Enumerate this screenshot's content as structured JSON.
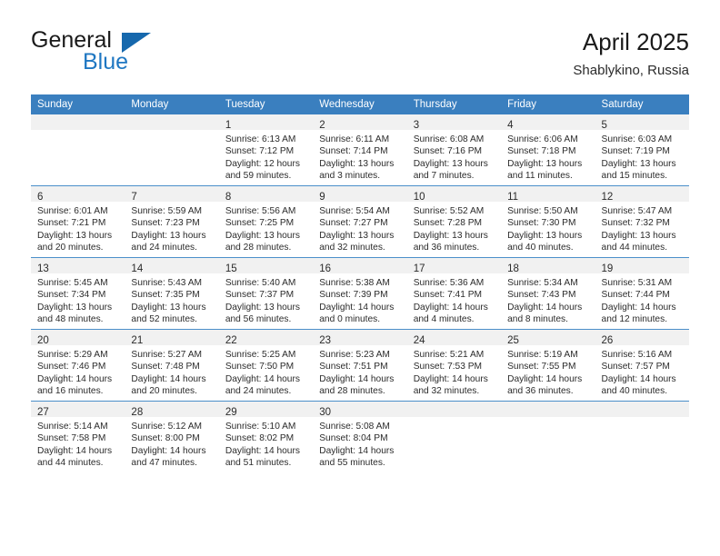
{
  "brand": {
    "name_top": "General",
    "name_bottom": "Blue",
    "accent_color": "#1f77c2",
    "triangle_color": "#1668ad"
  },
  "header": {
    "title": "April 2025",
    "subtitle": "Shablykino, Russia"
  },
  "calendar": {
    "header_bg": "#3a7fbf",
    "header_text_color": "#ffffff",
    "daynum_strip_bg": "#f1f1f1",
    "row_divider_color": "#4b8fca",
    "weekday_headers": [
      "Sunday",
      "Monday",
      "Tuesday",
      "Wednesday",
      "Thursday",
      "Friday",
      "Saturday"
    ],
    "weeks": [
      [
        {
          "day": "",
          "lines": []
        },
        {
          "day": "",
          "lines": []
        },
        {
          "day": "1",
          "lines": [
            "Sunrise: 6:13 AM",
            "Sunset: 7:12 PM",
            "Daylight: 12 hours",
            "and 59 minutes."
          ]
        },
        {
          "day": "2",
          "lines": [
            "Sunrise: 6:11 AM",
            "Sunset: 7:14 PM",
            "Daylight: 13 hours",
            "and 3 minutes."
          ]
        },
        {
          "day": "3",
          "lines": [
            "Sunrise: 6:08 AM",
            "Sunset: 7:16 PM",
            "Daylight: 13 hours",
            "and 7 minutes."
          ]
        },
        {
          "day": "4",
          "lines": [
            "Sunrise: 6:06 AM",
            "Sunset: 7:18 PM",
            "Daylight: 13 hours",
            "and 11 minutes."
          ]
        },
        {
          "day": "5",
          "lines": [
            "Sunrise: 6:03 AM",
            "Sunset: 7:19 PM",
            "Daylight: 13 hours",
            "and 15 minutes."
          ]
        }
      ],
      [
        {
          "day": "6",
          "lines": [
            "Sunrise: 6:01 AM",
            "Sunset: 7:21 PM",
            "Daylight: 13 hours",
            "and 20 minutes."
          ]
        },
        {
          "day": "7",
          "lines": [
            "Sunrise: 5:59 AM",
            "Sunset: 7:23 PM",
            "Daylight: 13 hours",
            "and 24 minutes."
          ]
        },
        {
          "day": "8",
          "lines": [
            "Sunrise: 5:56 AM",
            "Sunset: 7:25 PM",
            "Daylight: 13 hours",
            "and 28 minutes."
          ]
        },
        {
          "day": "9",
          "lines": [
            "Sunrise: 5:54 AM",
            "Sunset: 7:27 PM",
            "Daylight: 13 hours",
            "and 32 minutes."
          ]
        },
        {
          "day": "10",
          "lines": [
            "Sunrise: 5:52 AM",
            "Sunset: 7:28 PM",
            "Daylight: 13 hours",
            "and 36 minutes."
          ]
        },
        {
          "day": "11",
          "lines": [
            "Sunrise: 5:50 AM",
            "Sunset: 7:30 PM",
            "Daylight: 13 hours",
            "and 40 minutes."
          ]
        },
        {
          "day": "12",
          "lines": [
            "Sunrise: 5:47 AM",
            "Sunset: 7:32 PM",
            "Daylight: 13 hours",
            "and 44 minutes."
          ]
        }
      ],
      [
        {
          "day": "13",
          "lines": [
            "Sunrise: 5:45 AM",
            "Sunset: 7:34 PM",
            "Daylight: 13 hours",
            "and 48 minutes."
          ]
        },
        {
          "day": "14",
          "lines": [
            "Sunrise: 5:43 AM",
            "Sunset: 7:35 PM",
            "Daylight: 13 hours",
            "and 52 minutes."
          ]
        },
        {
          "day": "15",
          "lines": [
            "Sunrise: 5:40 AM",
            "Sunset: 7:37 PM",
            "Daylight: 13 hours",
            "and 56 minutes."
          ]
        },
        {
          "day": "16",
          "lines": [
            "Sunrise: 5:38 AM",
            "Sunset: 7:39 PM",
            "Daylight: 14 hours",
            "and 0 minutes."
          ]
        },
        {
          "day": "17",
          "lines": [
            "Sunrise: 5:36 AM",
            "Sunset: 7:41 PM",
            "Daylight: 14 hours",
            "and 4 minutes."
          ]
        },
        {
          "day": "18",
          "lines": [
            "Sunrise: 5:34 AM",
            "Sunset: 7:43 PM",
            "Daylight: 14 hours",
            "and 8 minutes."
          ]
        },
        {
          "day": "19",
          "lines": [
            "Sunrise: 5:31 AM",
            "Sunset: 7:44 PM",
            "Daylight: 14 hours",
            "and 12 minutes."
          ]
        }
      ],
      [
        {
          "day": "20",
          "lines": [
            "Sunrise: 5:29 AM",
            "Sunset: 7:46 PM",
            "Daylight: 14 hours",
            "and 16 minutes."
          ]
        },
        {
          "day": "21",
          "lines": [
            "Sunrise: 5:27 AM",
            "Sunset: 7:48 PM",
            "Daylight: 14 hours",
            "and 20 minutes."
          ]
        },
        {
          "day": "22",
          "lines": [
            "Sunrise: 5:25 AM",
            "Sunset: 7:50 PM",
            "Daylight: 14 hours",
            "and 24 minutes."
          ]
        },
        {
          "day": "23",
          "lines": [
            "Sunrise: 5:23 AM",
            "Sunset: 7:51 PM",
            "Daylight: 14 hours",
            "and 28 minutes."
          ]
        },
        {
          "day": "24",
          "lines": [
            "Sunrise: 5:21 AM",
            "Sunset: 7:53 PM",
            "Daylight: 14 hours",
            "and 32 minutes."
          ]
        },
        {
          "day": "25",
          "lines": [
            "Sunrise: 5:19 AM",
            "Sunset: 7:55 PM",
            "Daylight: 14 hours",
            "and 36 minutes."
          ]
        },
        {
          "day": "26",
          "lines": [
            "Sunrise: 5:16 AM",
            "Sunset: 7:57 PM",
            "Daylight: 14 hours",
            "and 40 minutes."
          ]
        }
      ],
      [
        {
          "day": "27",
          "lines": [
            "Sunrise: 5:14 AM",
            "Sunset: 7:58 PM",
            "Daylight: 14 hours",
            "and 44 minutes."
          ]
        },
        {
          "day": "28",
          "lines": [
            "Sunrise: 5:12 AM",
            "Sunset: 8:00 PM",
            "Daylight: 14 hours",
            "and 47 minutes."
          ]
        },
        {
          "day": "29",
          "lines": [
            "Sunrise: 5:10 AM",
            "Sunset: 8:02 PM",
            "Daylight: 14 hours",
            "and 51 minutes."
          ]
        },
        {
          "day": "30",
          "lines": [
            "Sunrise: 5:08 AM",
            "Sunset: 8:04 PM",
            "Daylight: 14 hours",
            "and 55 minutes."
          ]
        },
        {
          "day": "",
          "lines": []
        },
        {
          "day": "",
          "lines": []
        },
        {
          "day": "",
          "lines": []
        }
      ]
    ]
  }
}
